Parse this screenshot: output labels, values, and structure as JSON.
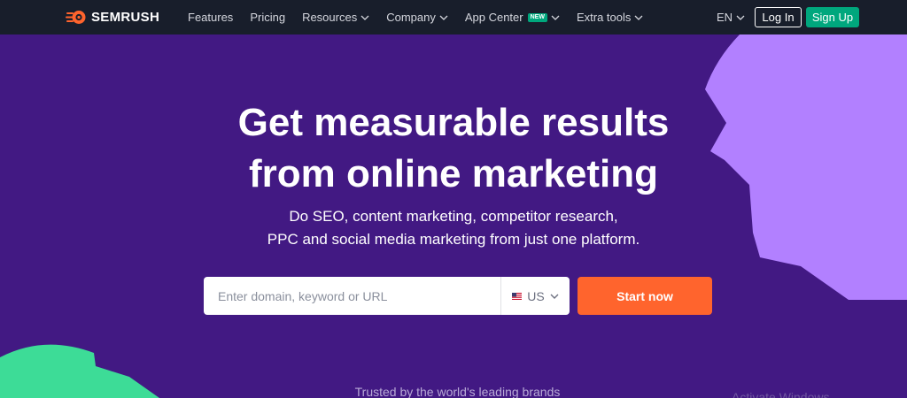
{
  "header": {
    "logo_text": "SEMRUSH",
    "nav": [
      {
        "label": "Features",
        "has_dropdown": false
      },
      {
        "label": "Pricing",
        "has_dropdown": false
      },
      {
        "label": "Resources",
        "has_dropdown": true
      },
      {
        "label": "Company",
        "has_dropdown": true
      },
      {
        "label": "App Center",
        "badge": "NEW",
        "has_dropdown": true
      },
      {
        "label": "Extra tools",
        "has_dropdown": true
      }
    ],
    "language": "EN",
    "login_label": "Log In",
    "signup_label": "Sign Up"
  },
  "hero": {
    "title_line1": "Get measurable results",
    "title_line2": "from online marketing",
    "subtitle_line1": "Do SEO, content marketing, competitor research,",
    "subtitle_line2": "PPC and social media marketing from just one platform.",
    "search_placeholder": "Enter domain, keyword or URL",
    "country": "US",
    "cta_label": "Start now"
  },
  "trusted_text": "Trusted by the world's leading brands",
  "watermark_text": "Activate Windows",
  "colors": {
    "background": "#421983",
    "topbar": "#181e2b",
    "accent_orange": "#ff642d",
    "accent_green": "#00a77d",
    "decor_purple": "#b280ff",
    "decor_green": "#3ddc97"
  },
  "icons": {
    "logo": "semrush-flame-icon",
    "dropdown": "chevron-down-icon",
    "flag": "us-flag-icon"
  }
}
